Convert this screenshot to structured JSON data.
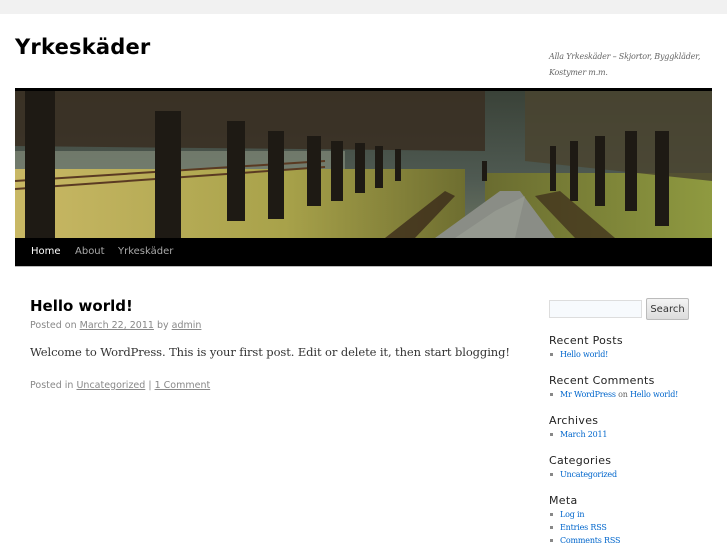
{
  "site": {
    "title": "Yrkeskäder",
    "description": "Alla Yrkeskäder – Skjortor, Byggkläder, Kostymer m.m."
  },
  "header_image": {
    "alt": "Tree-lined avenue with a path, fence and a person walking",
    "icon": "header-photo"
  },
  "nav": {
    "items": [
      {
        "label": "Home",
        "current": true
      },
      {
        "label": "About",
        "current": false
      },
      {
        "label": "Yrkeskäder",
        "current": false
      }
    ]
  },
  "post": {
    "title": "Hello world!",
    "posted_on_prefix": "Posted on",
    "date": "March 22, 2011",
    "by_text": "by",
    "author": "admin",
    "content": "Welcome to WordPress. This is your first post. Edit or delete it, then start blogging!",
    "posted_in_prefix": "Posted in",
    "category": "Uncategorized",
    "separator": "|",
    "comments": "1 Comment"
  },
  "sidebar": {
    "search": {
      "value": "",
      "placeholder": "",
      "button_label": "Search"
    },
    "recent_posts": {
      "title": "Recent Posts",
      "items": [
        "Hello world!"
      ]
    },
    "recent_comments": {
      "title": "Recent Comments",
      "items": [
        {
          "author": "Mr WordPress",
          "on": "on",
          "post": "Hello world!"
        }
      ]
    },
    "archives": {
      "title": "Archives",
      "items": [
        "March 2011"
      ]
    },
    "categories": {
      "title": "Categories",
      "items": [
        "Uncategorized"
      ]
    },
    "meta": {
      "title": "Meta",
      "items": [
        "Log in",
        "Entries RSS",
        "Comments RSS"
      ]
    }
  },
  "colors": {
    "link": "#0066cc",
    "nav_bg": "#000000",
    "nav_text": "#aaaaaa",
    "nav_current": "#ffffff",
    "top_band": "#f1f1f1"
  }
}
